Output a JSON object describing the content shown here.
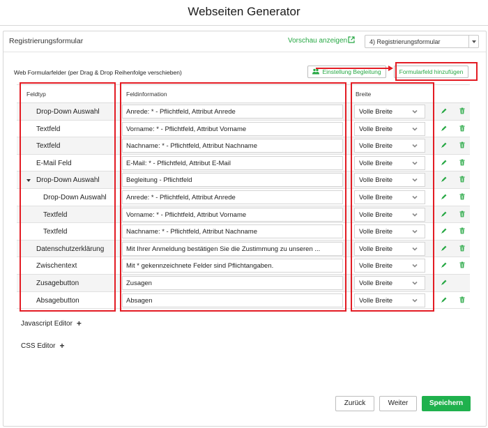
{
  "app": {
    "title": "Webseiten Generator"
  },
  "panel": {
    "title": "Registrierungsformular",
    "preview_label": "Vorschau anzeigen",
    "page_select": {
      "value": "4) Registrierungsformular"
    }
  },
  "fields_section": {
    "label": "Web Formularfelder (per Drag & Drop Reihenfolge verschieben)",
    "begleitung_button": "Einstellung Begleitung",
    "add_field_button": "Formularfeld hinzufügen"
  },
  "table": {
    "headers": {
      "type": "Feldtyp",
      "info": "Feldinformation",
      "width": "Breite"
    },
    "rows": [
      {
        "type": "Drop-Down Auswahl",
        "info": "Anrede: * - Pflichtfeld, Attribut Anrede",
        "width": "Volle Breite",
        "level": 0,
        "deletable": true,
        "collapsible": false
      },
      {
        "type": "Textfeld",
        "info": "Vorname: * - Pflichtfeld, Attribut Vorname",
        "width": "Volle Breite",
        "level": 0,
        "deletable": true,
        "collapsible": false
      },
      {
        "type": "Textfeld",
        "info": "Nachname: * - Pflichtfeld, Attribut Nachname",
        "width": "Volle Breite",
        "level": 0,
        "deletable": true,
        "collapsible": false
      },
      {
        "type": "E-Mail Feld",
        "info": "E-Mail: * - Pflichtfeld, Attribut E-Mail",
        "width": "Volle Breite",
        "level": 0,
        "deletable": true,
        "collapsible": false
      },
      {
        "type": "Drop-Down Auswahl",
        "info": "Begleitung - Pflichtfeld",
        "width": "Volle Breite",
        "level": 0,
        "deletable": true,
        "collapsible": true
      },
      {
        "type": "Drop-Down Auswahl",
        "info": "Anrede: * - Pflichtfeld, Attribut Anrede",
        "width": "Volle Breite",
        "level": 1,
        "deletable": true,
        "collapsible": false
      },
      {
        "type": "Textfeld",
        "info": "Vorname: * - Pflichtfeld, Attribut Vorname",
        "width": "Volle Breite",
        "level": 1,
        "deletable": true,
        "collapsible": false
      },
      {
        "type": "Textfeld",
        "info": "Nachname: * - Pflichtfeld, Attribut Nachname",
        "width": "Volle Breite",
        "level": 1,
        "deletable": true,
        "collapsible": false
      },
      {
        "type": "Datenschutzerklärung",
        "info": "Mit Ihrer Anmeldung bestätigen Sie die Zustimmung zu unseren ...",
        "width": "Volle Breite",
        "level": 0,
        "deletable": true,
        "collapsible": false
      },
      {
        "type": "Zwischentext",
        "info": "Mit * gekennzeichnete Felder sind Pflichtangaben.",
        "width": "Volle Breite",
        "level": 0,
        "deletable": true,
        "collapsible": false
      },
      {
        "type": "Zusagebutton",
        "info": "Zusagen",
        "width": "Volle Breite",
        "level": 0,
        "deletable": false,
        "collapsible": false
      },
      {
        "type": "Absagebutton",
        "info": "Absagen",
        "width": "Volle Breite",
        "level": 0,
        "deletable": true,
        "collapsible": false
      }
    ]
  },
  "editors": {
    "javascript": "Javascript Editor",
    "css": "CSS Editor"
  },
  "footer": {
    "back": "Zurück",
    "next": "Weiter",
    "save": "Speichern"
  },
  "colors": {
    "accent_green": "#1fb14d",
    "annotation_red": "#e31b23"
  },
  "icons": {
    "preview": "external-link-icon",
    "begleitung": "users-icon",
    "edit": "pencil-icon",
    "delete": "trash-icon",
    "width_select": "chevron-down-icon",
    "editor_expand": "plus-icon"
  }
}
